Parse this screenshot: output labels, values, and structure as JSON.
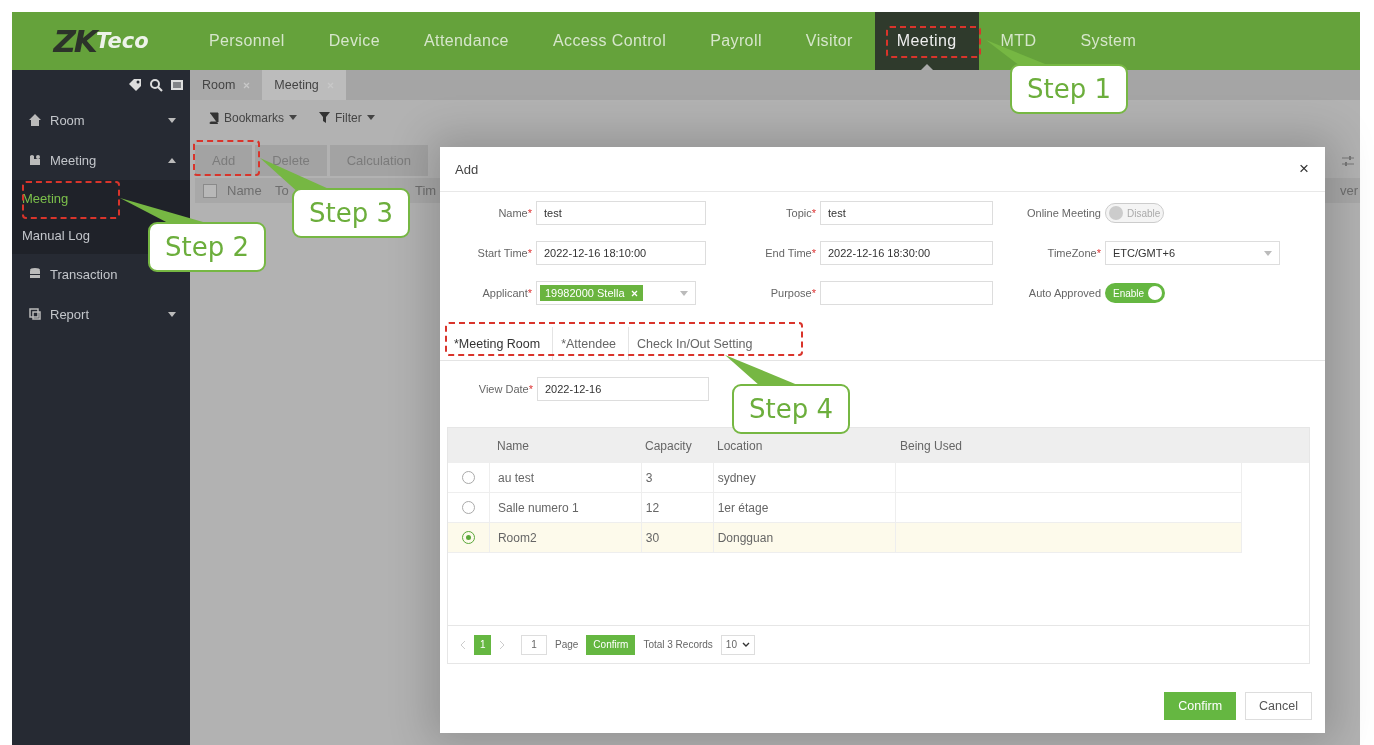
{
  "header": {
    "logo": [
      "ZK",
      "Teco"
    ],
    "nav": [
      {
        "label": "Personnel",
        "selected": false
      },
      {
        "label": "Device",
        "selected": false
      },
      {
        "label": "Attendance",
        "selected": false
      },
      {
        "label": "Access Control",
        "selected": false
      },
      {
        "label": "Payroll",
        "selected": false
      },
      {
        "label": "Visitor",
        "selected": false
      },
      {
        "label": "Meeting",
        "selected": true
      },
      {
        "label": "MTD",
        "selected": false
      },
      {
        "label": "System",
        "selected": false
      }
    ]
  },
  "sidebar": {
    "items": [
      {
        "label": "Room",
        "expanded": false
      },
      {
        "label": "Meeting",
        "expanded": true,
        "children": [
          {
            "label": "Meeting",
            "selected": true
          },
          {
            "label": "Manual Log",
            "selected": false
          }
        ]
      },
      {
        "label": "Transaction"
      },
      {
        "label": "Report",
        "expanded": false
      }
    ]
  },
  "tabs": [
    {
      "label": "Room",
      "selected": false
    },
    {
      "label": "Meeting",
      "selected": true
    }
  ],
  "toolbar": [
    "Bookmarks",
    "Filter"
  ],
  "actions": [
    "Add",
    "Delete",
    "Calculation"
  ],
  "list_header": {
    "checked": false,
    "columns": [
      "Name",
      "To",
      "Tim",
      "ver"
    ]
  },
  "dialog": {
    "title": "Add",
    "close": "×",
    "fields": [
      {
        "kind": "text",
        "label": "Name",
        "mark": "*",
        "value": "test"
      },
      {
        "kind": "text",
        "label": "Topic",
        "mark": "*",
        "value": "test"
      },
      {
        "kind": "toggle",
        "label": "Online Meeting",
        "on": false,
        "text": "Disable"
      },
      {
        "kind": "text",
        "label": "Start Time",
        "mark": "*",
        "value": "2022-12-16 18:10:00"
      },
      {
        "kind": "text",
        "label": "End Time",
        "mark": "*",
        "value": "2022-12-16 18:30:00"
      },
      {
        "kind": "select",
        "label": "TimeZone",
        "mark": "*",
        "value": "ETC/GMT+6"
      },
      {
        "kind": "tags",
        "label": "Applicant",
        "mark": "*",
        "tags": [
          "19982000 Stella"
        ]
      },
      {
        "kind": "text",
        "label": "Purpose",
        "mark": "*"
      },
      {
        "kind": "toggle",
        "label": "Auto Approved",
        "on": true,
        "text": "Enable"
      }
    ],
    "tabs": [
      {
        "label": "*Meeting Room",
        "selected": true
      },
      {
        "label": "*Attendee",
        "selected": false
      },
      {
        "label": "Check In/Out Setting",
        "selected": false
      }
    ],
    "view_date": {
      "label": "View Date",
      "mark": "*",
      "value": "2022-12-16"
    },
    "rooms": {
      "columns": [
        "Name",
        "Capacity",
        "Location",
        "Being Used"
      ],
      "rows": [
        {
          "selected": false,
          "cells": [
            "au test",
            "3",
            "sydney"
          ]
        },
        {
          "selected": false,
          "cells": [
            "Salle numero 1",
            "12",
            "1er étage"
          ]
        },
        {
          "selected": true,
          "cells": [
            "Room2",
            "30",
            "Dongguan"
          ]
        }
      ]
    },
    "pagination": {
      "page": "1",
      "page_input": "1",
      "page_label": "Page",
      "go": "Confirm",
      "total": "Total 3 Records",
      "size": "10"
    },
    "buttons": [
      {
        "label": "Confirm",
        "kind": "primary"
      },
      {
        "label": "Cancel",
        "kind": "default"
      }
    ]
  },
  "callouts": [
    {
      "label": "Step 1"
    },
    {
      "label": "Step 2"
    },
    {
      "label": "Step 3"
    },
    {
      "label": "Step 4"
    }
  ]
}
